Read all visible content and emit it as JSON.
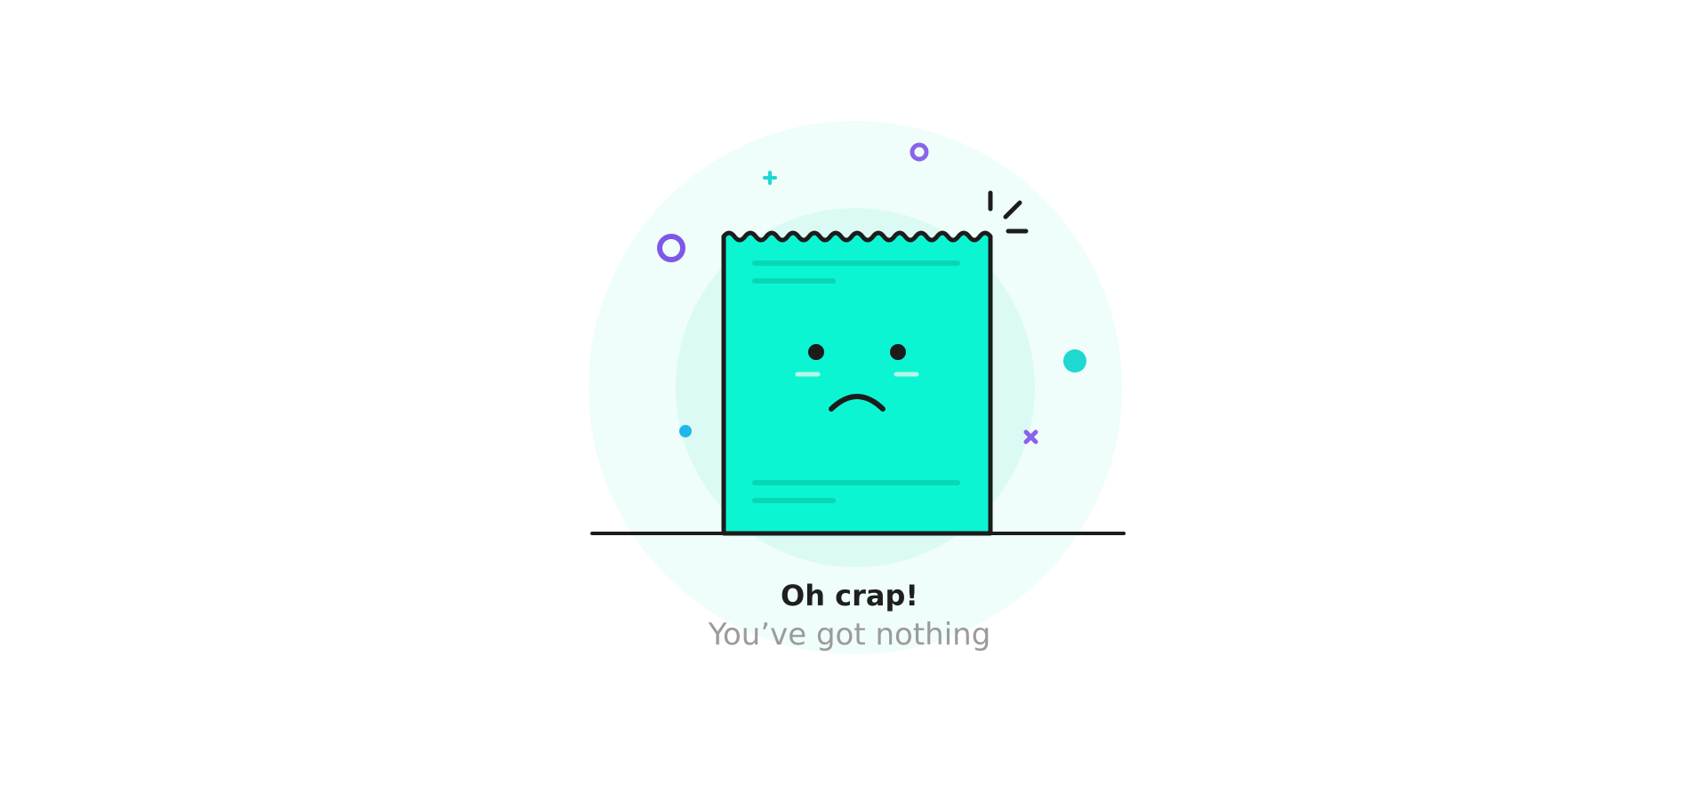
{
  "empty_state": {
    "title": "Oh crap!",
    "subtitle": "You’ve got nothing",
    "illustration": {
      "subject": "sad-receipt-icon",
      "decorations": [
        "ring-icon",
        "plus-icon",
        "dot-icon",
        "cross-icon",
        "burst-lines-icon"
      ]
    }
  },
  "colors": {
    "background": "#ffffff",
    "halo_outer": "#effdfb",
    "halo_inner": "#dcfaf4",
    "receipt_fill": "#0cf5d3",
    "receipt_lines": "#08d7b7",
    "outline": "#1c1c1c",
    "purple_accent": "#7e57e8",
    "teal_accent": "#1fd8d0",
    "blue_accent": "#1fb7ec",
    "title_text": "#1f1f1f",
    "subtitle_text": "#9b9b9b"
  }
}
